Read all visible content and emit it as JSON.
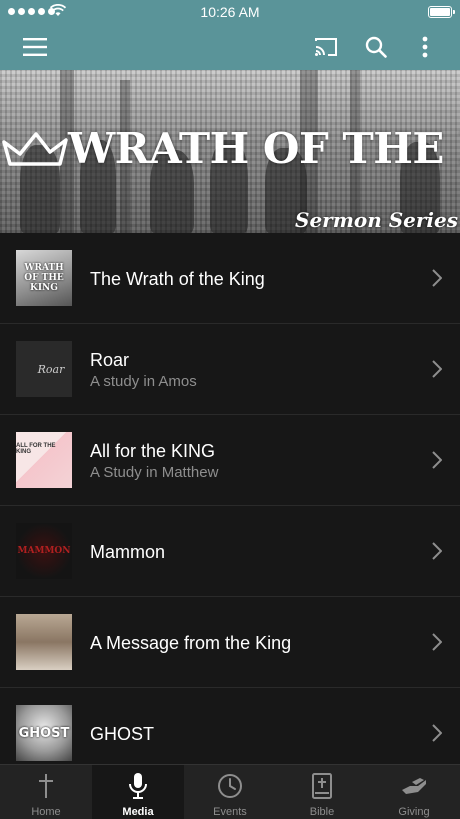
{
  "status_bar": {
    "time": "10:26 AM",
    "battery_level": 1.0
  },
  "app_bar": {
    "icons": [
      "menu-icon",
      "cast-icon",
      "search-icon",
      "more-vert-icon"
    ]
  },
  "banner": {
    "title": "WRATH OF THE KING",
    "subtitle": "Sermon Series"
  },
  "series": [
    {
      "title": "The Wrath of the King",
      "subtitle": "",
      "thumb_text": "WRATH OF THE KING"
    },
    {
      "title": "Roar",
      "subtitle": "A study in Amos",
      "thumb_text": "Roar"
    },
    {
      "title": "All for the KING",
      "subtitle": "A Study in Matthew",
      "thumb_text": "ALL FOR THE KING"
    },
    {
      "title": "Mammon",
      "subtitle": "",
      "thumb_text": "MAMMON"
    },
    {
      "title": "A Message from the King",
      "subtitle": "",
      "thumb_text": ""
    },
    {
      "title": "GHOST",
      "subtitle": "",
      "thumb_text": "GHOST"
    }
  ],
  "tabs": [
    {
      "label": "Home",
      "icon": "cross-icon",
      "active": false
    },
    {
      "label": "Media",
      "icon": "microphone-icon",
      "active": true
    },
    {
      "label": "Events",
      "icon": "clock-icon",
      "active": false
    },
    {
      "label": "Bible",
      "icon": "bible-icon",
      "active": false
    },
    {
      "label": "Giving",
      "icon": "giving-hand-icon",
      "active": false
    }
  ],
  "colors": {
    "accent": "#5a9499",
    "background": "#171717",
    "tabbar": "#232323"
  }
}
